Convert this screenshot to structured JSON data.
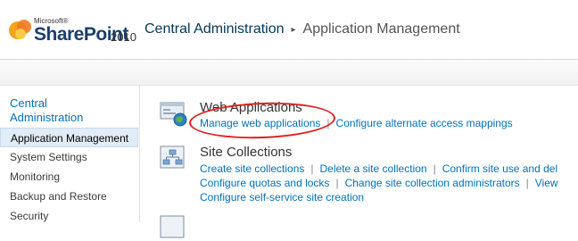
{
  "header": {
    "logo_small": "Microsoft®",
    "logo_name": "SharePoint",
    "logo_year": "2010",
    "breadcrumb": [
      "Central Administration",
      "Application Management"
    ],
    "separator": "▸"
  },
  "sidebar": {
    "heading_line1": "Central",
    "heading_line2": "Administration",
    "items": [
      {
        "label": "Application Management",
        "selected": true
      },
      {
        "label": "System Settings",
        "selected": false
      },
      {
        "label": "Monitoring",
        "selected": false
      },
      {
        "label": "Backup and Restore",
        "selected": false
      },
      {
        "label": "Security",
        "selected": false
      }
    ]
  },
  "main": {
    "sections": [
      {
        "title": "Web Applications",
        "icon": "web-applications-icon",
        "links": [
          [
            "Manage web applications",
            "Configure alternate access mappings"
          ]
        ]
      },
      {
        "title": "Site Collections",
        "icon": "site-collections-icon",
        "links": [
          [
            "Create site collections",
            "Delete a site collection",
            "Confirm site use and del"
          ],
          [
            "Configure quotas and locks",
            "Change site collection administrators",
            "View"
          ],
          [
            "Configure self-service site creation"
          ]
        ]
      }
    ]
  },
  "colors": {
    "link": "#0072bc",
    "nav_selected_bg": "#e1ecf7",
    "annotation": "#e02020"
  }
}
